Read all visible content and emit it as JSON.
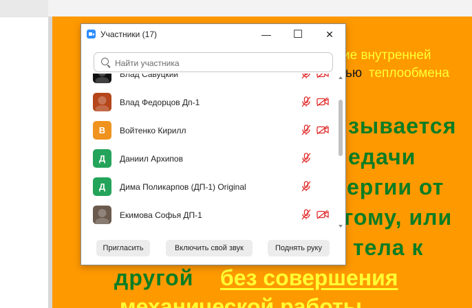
{
  "slide": {
    "line1": "ие  внутренней",
    "line2a": "ью",
    "line2b": "теплообмена",
    "line3": "зывается",
    "line4": "едачи",
    "line5": "ергии от",
    "line6": "гому, или",
    "line7": "тела к",
    "line8a": "другой",
    "line8b": "без совершения",
    "line9": "механической работы"
  },
  "window": {
    "title": "Участники (17)",
    "minimize_icon": "—",
    "maximize_icon": "☐",
    "close_icon": "✕"
  },
  "search": {
    "placeholder": "Найти участника",
    "value": ""
  },
  "participants": [
    {
      "name": "Влад Савуцкий",
      "avatar_type": "photo",
      "avatar_color": "#111111",
      "mic": "muted",
      "video": "off"
    },
    {
      "name": "Влад Федорцов Дп-1",
      "avatar_type": "photo",
      "avatar_color": "#b5461b",
      "mic": "muted",
      "video": "off"
    },
    {
      "name": "Войтенко Кирилл",
      "avatar_type": "letter",
      "avatar_letter": "В",
      "avatar_color": "#f0931e",
      "mic": "muted",
      "video": "off"
    },
    {
      "name": "Даниил Архипов",
      "avatar_type": "letter",
      "avatar_letter": "Д",
      "avatar_color": "#23a45a",
      "mic": "muted",
      "video": "none"
    },
    {
      "name": "Дима Поликарпов (ДП-1) Original",
      "avatar_type": "letter",
      "avatar_letter": "Д",
      "avatar_color": "#23a45a",
      "mic": "muted",
      "video": "none"
    },
    {
      "name": "Екимова Софья ДП-1",
      "avatar_type": "photo",
      "avatar_color": "#6b5a4e",
      "mic": "muted",
      "video": "off"
    }
  ],
  "footer": {
    "invite": "Пригласить",
    "unmute": "Включить свой звук",
    "raise_hand": "Поднять руку"
  },
  "colors": {
    "slide_bg": "#ff9900",
    "slide_green": "#0a7d24",
    "slide_yellow": "#ffff33",
    "mute_red": "#e02828",
    "zoom_blue": "#2d8cff"
  }
}
